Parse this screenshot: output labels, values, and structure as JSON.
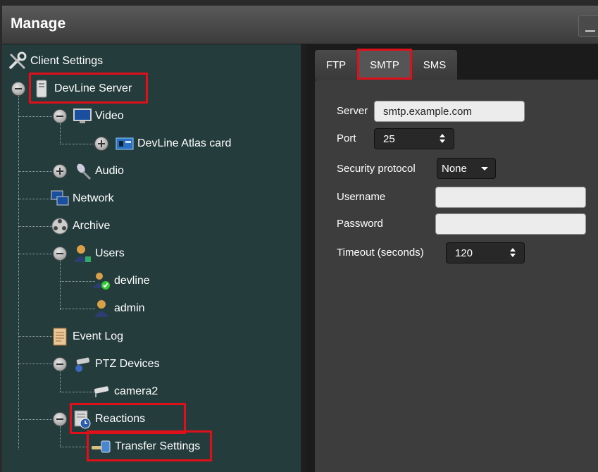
{
  "window": {
    "title": "Manage"
  },
  "tree": {
    "items": [
      {
        "label": "Client Settings",
        "icon": "tools-icon"
      },
      {
        "label": "DevLine Server",
        "icon": "server-icon",
        "expanded": true
      },
      {
        "label": "Video",
        "icon": "monitor-icon",
        "expanded": true
      },
      {
        "label": "DevLine Atlas card",
        "icon": "capture-card-icon",
        "expanded": false
      },
      {
        "label": "Audio",
        "icon": "microphone-icon",
        "expanded": false
      },
      {
        "label": "Network",
        "icon": "network-icon"
      },
      {
        "label": "Archive",
        "icon": "film-reel-icon"
      },
      {
        "label": "Users",
        "icon": "users-icon",
        "expanded": true
      },
      {
        "label": "devline",
        "icon": "user-active-icon"
      },
      {
        "label": "admin",
        "icon": "user-icon"
      },
      {
        "label": "Event Log",
        "icon": "log-icon"
      },
      {
        "label": "PTZ Devices",
        "icon": "ptz-camera-icon",
        "expanded": true
      },
      {
        "label": "camera2",
        "icon": "camera-icon"
      },
      {
        "label": "Reactions",
        "icon": "reactions-icon",
        "expanded": true
      },
      {
        "label": "Transfer Settings",
        "icon": "transfer-icon"
      }
    ]
  },
  "tabs": [
    {
      "label": "FTP"
    },
    {
      "label": "SMTP",
      "active": true
    },
    {
      "label": "SMS"
    }
  ],
  "smtp": {
    "server_label": "Server",
    "server_value": "smtp.example.com",
    "port_label": "Port",
    "port_value": "25",
    "security_label": "Security protocol",
    "security_value": "None",
    "username_label": "Username",
    "username_value": "",
    "password_label": "Password",
    "password_value": "",
    "timeout_label": "Timeout (seconds)",
    "timeout_value": "120"
  },
  "colors": {
    "highlight": "#e0101a",
    "tree_bg": "#253c3c",
    "panel_bg": "#3d3d3d"
  }
}
